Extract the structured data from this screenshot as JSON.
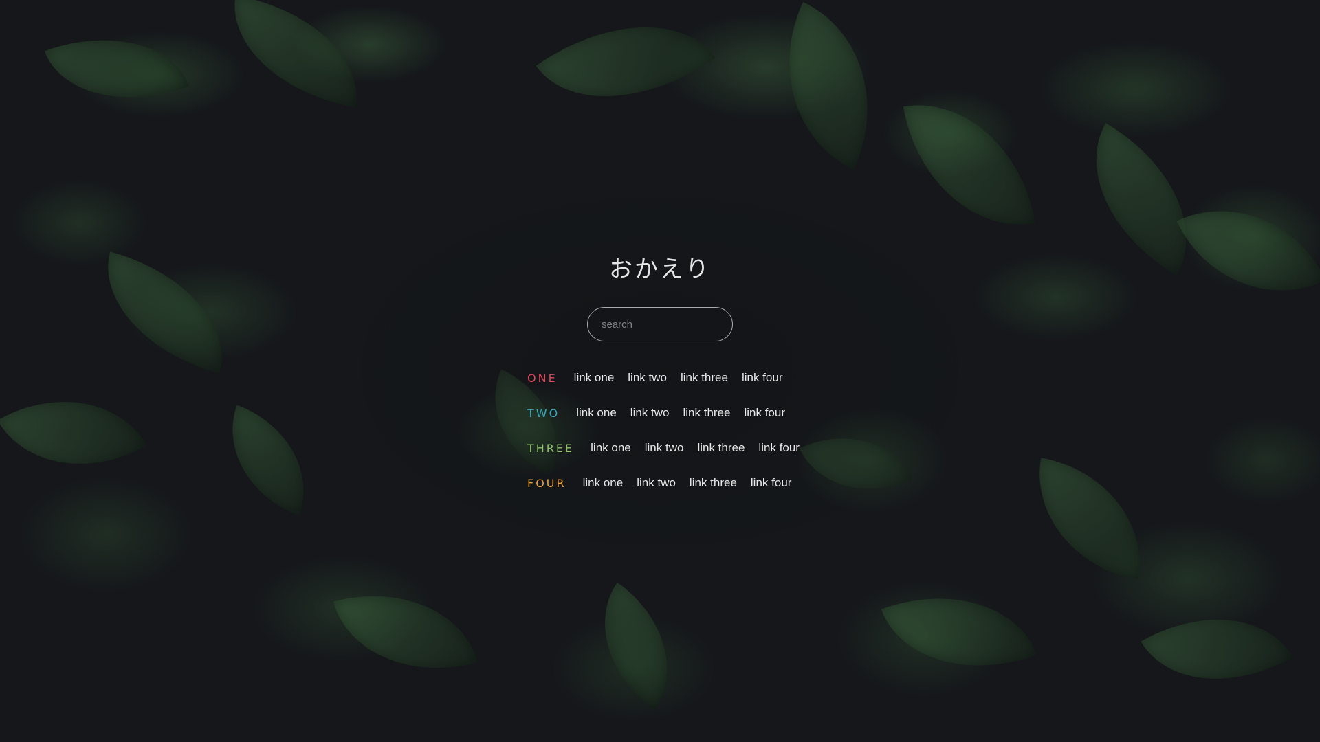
{
  "title": "おかえり",
  "search": {
    "placeholder": "search"
  },
  "rows": [
    {
      "label": "ONE",
      "color": "#e0455a",
      "links": [
        "link one",
        "link two",
        "link three",
        "link four"
      ]
    },
    {
      "label": "TWO",
      "color": "#3aa6b9",
      "links": [
        "link one",
        "link two",
        "link three",
        "link four"
      ]
    },
    {
      "label": "THREE",
      "color": "#8fbf6a",
      "links": [
        "link one",
        "link two",
        "link three",
        "link four"
      ]
    },
    {
      "label": "FOUR",
      "color": "#e8a23a",
      "links": [
        "link one",
        "link two",
        "link three",
        "link four"
      ]
    }
  ]
}
